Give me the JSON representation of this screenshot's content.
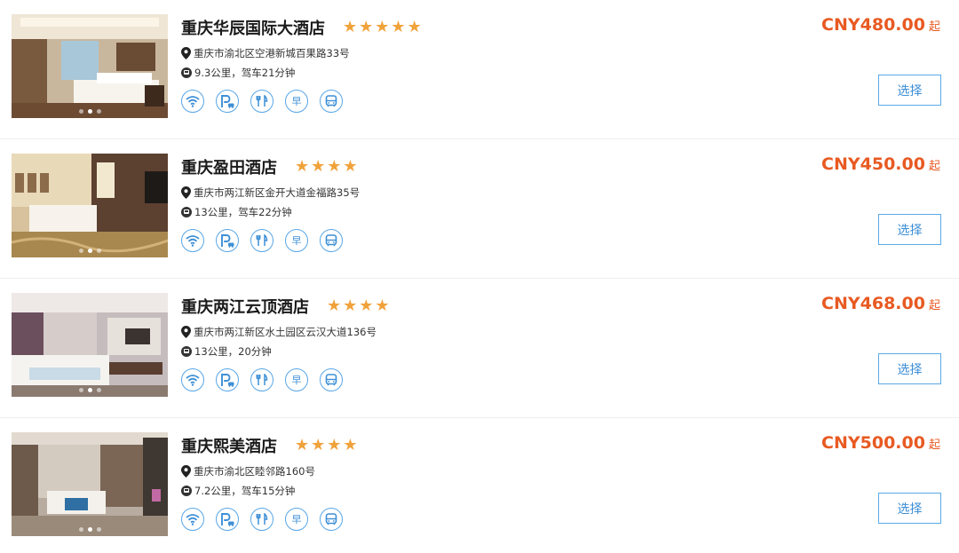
{
  "hotels": [
    {
      "name": "重庆华辰国际大酒店",
      "stars": 5,
      "address": "重庆市渝北区空港新城百果路33号",
      "distance": "9.3公里，驾车21分钟",
      "price": "CNY480.00",
      "price_suffix": "起",
      "select_label": "选择",
      "photo_dots": 3,
      "active_dot": 1
    },
    {
      "name": "重庆盈田酒店",
      "stars": 4,
      "address": "重庆市两江新区金开大道金福路35号",
      "distance": "13公里，驾车22分钟",
      "price": "CNY450.00",
      "price_suffix": "起",
      "select_label": "选择",
      "photo_dots": 3,
      "active_dot": 1
    },
    {
      "name": "重庆两江云顶酒店",
      "stars": 4,
      "address": "重庆市两江新区水土园区云汉大道136号",
      "distance": "13公里，20分钟",
      "price": "CNY468.00",
      "price_suffix": "起",
      "select_label": "选择",
      "photo_dots": 3,
      "active_dot": 1
    },
    {
      "name": "重庆熙美酒店",
      "stars": 4,
      "address": "重庆市渝北区睦邻路160号",
      "distance": "7.2公里，驾车15分钟",
      "price": "CNY500.00",
      "price_suffix": "起",
      "select_label": "选择",
      "photo_dots": 3,
      "active_dot": 1
    }
  ],
  "amenities": [
    {
      "icon": "wifi-icon"
    },
    {
      "icon": "parking-icon"
    },
    {
      "icon": "restaurant-icon"
    },
    {
      "icon": "breakfast-icon",
      "label": "早"
    },
    {
      "icon": "shuttle-bus-icon"
    }
  ],
  "colors": {
    "price": "#e85a22",
    "star": "#f0a23b",
    "accent": "#3d8fd6"
  }
}
